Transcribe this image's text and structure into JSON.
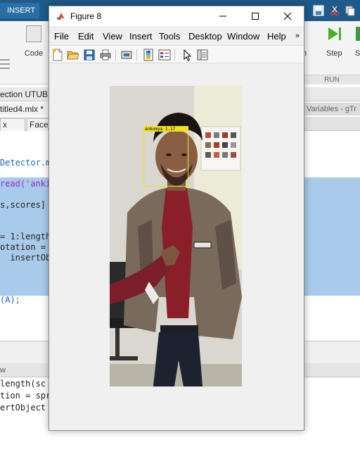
{
  "background": {
    "ribbon": {
      "tab_label": "INSERT",
      "code_label": "Code",
      "run_label_partial": "n",
      "step_label": "Step",
      "s_label": "S",
      "run_group_label": "RUN"
    },
    "path_text": "ection UTUBE",
    "doc_tab": "titled4.mlx *",
    "variables_header": "Variables - gTr",
    "file_tabs": [
      "x",
      "Face_"
    ],
    "variables_tab": "×",
    "editor_lines": [
      "Detector.ma",
      "read('ankin",
      "s,scores] =",
      "= 1:length(",
      "otation = s",
      "  insertObje",
      "(A);"
    ],
    "command_header": "w",
    "command_lines": [
      "length(sc",
      "tion = spri",
      "ertObject                                on);"
    ]
  },
  "figure": {
    "title": "Figure 8",
    "menu": [
      "File",
      "Edit",
      "View",
      "Insert",
      "Tools",
      "Desktop",
      "Window",
      "Help"
    ],
    "menu_overflow": "»",
    "toolbar_icons": [
      "new-figure-icon",
      "open-file-icon",
      "save-icon",
      "print-icon",
      "link-plot-icon",
      "insert-colorbar-icon",
      "insert-legend-icon",
      "edit-plot-icon",
      "property-inspector-icon"
    ],
    "detection_label": "ankomya  1.17",
    "bbox_color": "#f0e020"
  }
}
